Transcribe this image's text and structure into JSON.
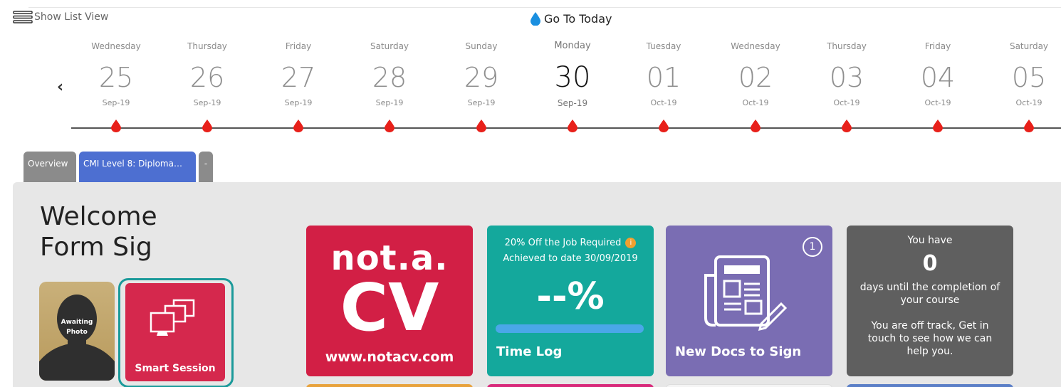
{
  "toolbar": {
    "list_view_label": "Show List View",
    "go_today_label": "Go To Today"
  },
  "calendar": {
    "days": [
      {
        "dow": "Wednesday",
        "num": "25",
        "mon": "Sep-19"
      },
      {
        "dow": "Thursday",
        "num": "26",
        "mon": "Sep-19"
      },
      {
        "dow": "Friday",
        "num": "27",
        "mon": "Sep-19"
      },
      {
        "dow": "Saturday",
        "num": "28",
        "mon": "Sep-19"
      },
      {
        "dow": "Sunday",
        "num": "29",
        "mon": "Sep-19"
      },
      {
        "dow": "Monday",
        "num": "30",
        "mon": "Sep-19"
      },
      {
        "dow": "Tuesday",
        "num": "01",
        "mon": "Oct-19"
      },
      {
        "dow": "Wednesday",
        "num": "02",
        "mon": "Oct-19"
      },
      {
        "dow": "Thursday",
        "num": "03",
        "mon": "Oct-19"
      },
      {
        "dow": "Friday",
        "num": "04",
        "mon": "Oct-19"
      },
      {
        "dow": "Saturday",
        "num": "05",
        "mon": "Oct-19"
      }
    ],
    "today_index": 5,
    "prev_icon": "chevron-left-icon",
    "marker_color": "#e8201a"
  },
  "tabs": {
    "overview": "Overview",
    "course": "CMI Level 8: Diploma…",
    "more": "-"
  },
  "welcome": {
    "line1": "Welcome",
    "line2": "Form Sig"
  },
  "avatar": {
    "label_line1": "Awaiting",
    "label_line2": "Photo"
  },
  "smart_session": {
    "label": "Smart Session",
    "icon": "monitors-icon"
  },
  "tiles": {
    "cv": {
      "logo_top": "not.a.",
      "logo_mid": "CV",
      "url": "www.notacv.com",
      "color": "#d21f45"
    },
    "timelog": {
      "line1": "20% Off the Job Required",
      "line2": "Achieved to date 30/09/2019",
      "info": "i",
      "percent": "--%",
      "progress": 0,
      "label": "Time Log",
      "color": "#14a89c"
    },
    "docs": {
      "badge": "1",
      "label": "New Docs to Sign",
      "icon": "newspaper-pen-icon",
      "color": "#7a6db3"
    },
    "days": {
      "line1": "You have",
      "number": "0",
      "line2": "days until the completion of",
      "line3": "your course",
      "line4": "You are off track, Get in",
      "line5": "touch to see how we can",
      "line6": "help you.",
      "color": "#5f5f5f"
    }
  }
}
